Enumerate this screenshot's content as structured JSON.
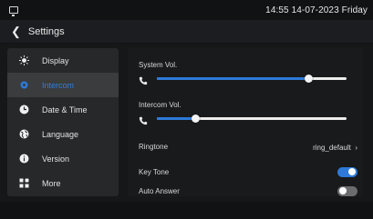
{
  "statusbar": {
    "clock": "14:55 14-07-2023 Friday"
  },
  "header": {
    "back_icon": "chevron-left",
    "title": "Settings"
  },
  "sidebar": {
    "items": [
      {
        "label": "Display",
        "icon": "sun-icon",
        "active": false
      },
      {
        "label": "Intercom",
        "icon": "gear-icon",
        "active": true
      },
      {
        "label": "Date & Time",
        "icon": "clock-icon",
        "active": false
      },
      {
        "label": "Language",
        "icon": "globe-icon",
        "active": false
      },
      {
        "label": "Version",
        "icon": "info-icon",
        "active": false
      },
      {
        "label": "More",
        "icon": "grid-icon",
        "active": false
      }
    ]
  },
  "main": {
    "system_vol": {
      "label": "System Vol.",
      "level": 0.8
    },
    "intercom_vol": {
      "label": "Intercom Vol.",
      "level": 0.2
    },
    "ringtone": {
      "label": "Ringtone",
      "value": "ring_default"
    },
    "key_tone": {
      "label": "Key Tone",
      "on": true
    },
    "auto_answer": {
      "label": "Auto Answer",
      "on": false
    }
  },
  "colors": {
    "accent": "#2d7ad8",
    "background": "#151719",
    "panel": "#262829"
  }
}
